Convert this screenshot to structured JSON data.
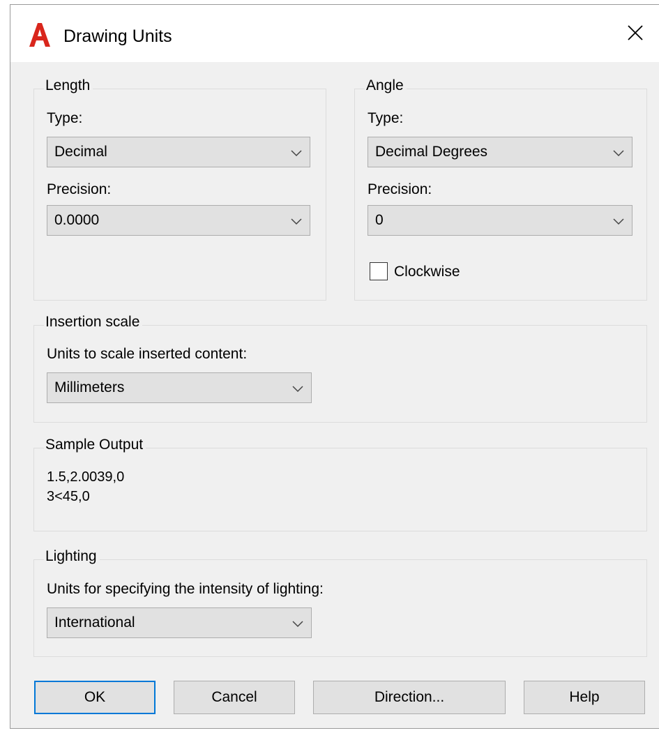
{
  "dialog": {
    "title": "Drawing Units",
    "close_icon": "close-icon",
    "app_icon": "autocad-logo-icon",
    "brand_color": "#d9261c"
  },
  "length": {
    "legend": "Length",
    "type_label": "Type:",
    "type_value": "Decimal",
    "precision_label": "Precision:",
    "precision_value": "0.0000"
  },
  "angle": {
    "legend": "Angle",
    "type_label": "Type:",
    "type_value": "Decimal Degrees",
    "precision_label": "Precision:",
    "precision_value": "0",
    "clockwise_label": "Clockwise",
    "clockwise_checked": false
  },
  "insertion": {
    "legend": "Insertion scale",
    "label": "Units to scale inserted content:",
    "value": "Millimeters"
  },
  "sample": {
    "legend": "Sample Output",
    "line1": "1.5,2.0039,0",
    "line2": "3<45,0"
  },
  "lighting": {
    "legend": "Lighting",
    "label": "Units for specifying the intensity of lighting:",
    "value": "International"
  },
  "buttons": {
    "ok": "OK",
    "cancel": "Cancel",
    "direction": "Direction...",
    "help": "Help"
  },
  "colors": {
    "focus_border": "#0078d7",
    "dialog_bg": "#f0f0f0",
    "button_bg": "#e1e1e1"
  }
}
